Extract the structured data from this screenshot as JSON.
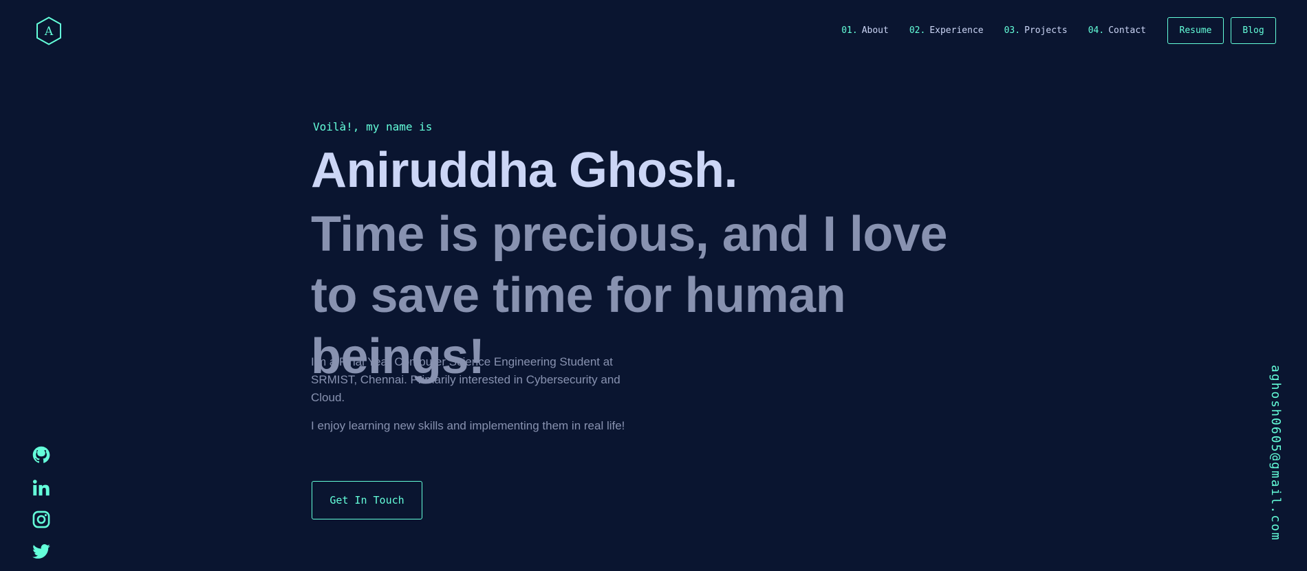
{
  "header": {
    "logo_letter": "A",
    "nav": [
      {
        "num": "01.",
        "label": "About"
      },
      {
        "num": "02.",
        "label": "Experience"
      },
      {
        "num": "03.",
        "label": "Projects"
      },
      {
        "num": "04.",
        "label": "Contact"
      }
    ],
    "resume_label": "Resume",
    "blog_label": "Blog"
  },
  "hero": {
    "greeting": "Voilà!, my name is",
    "name": "Aniruddha Ghosh.",
    "tagline": "Time is precious, and I love to save time for human beings!",
    "bio": "I'm a Final Year Computer Science Engineering Student at SRMIST, Chennai. Primarily interested in Cybersecurity and Cloud.",
    "bio2": "I enjoy learning new skills and implementing them in real life!",
    "cta_label": "Get In Touch"
  },
  "social": {
    "icons": [
      "github-icon",
      "linkedin-icon",
      "instagram-icon",
      "twitter-icon"
    ]
  },
  "email": "aghosh0605@gmail.com",
  "colors": {
    "background": "#0a1530",
    "accent": "#64ffda",
    "heading": "#ccd6f6",
    "text": "#8892b0"
  }
}
